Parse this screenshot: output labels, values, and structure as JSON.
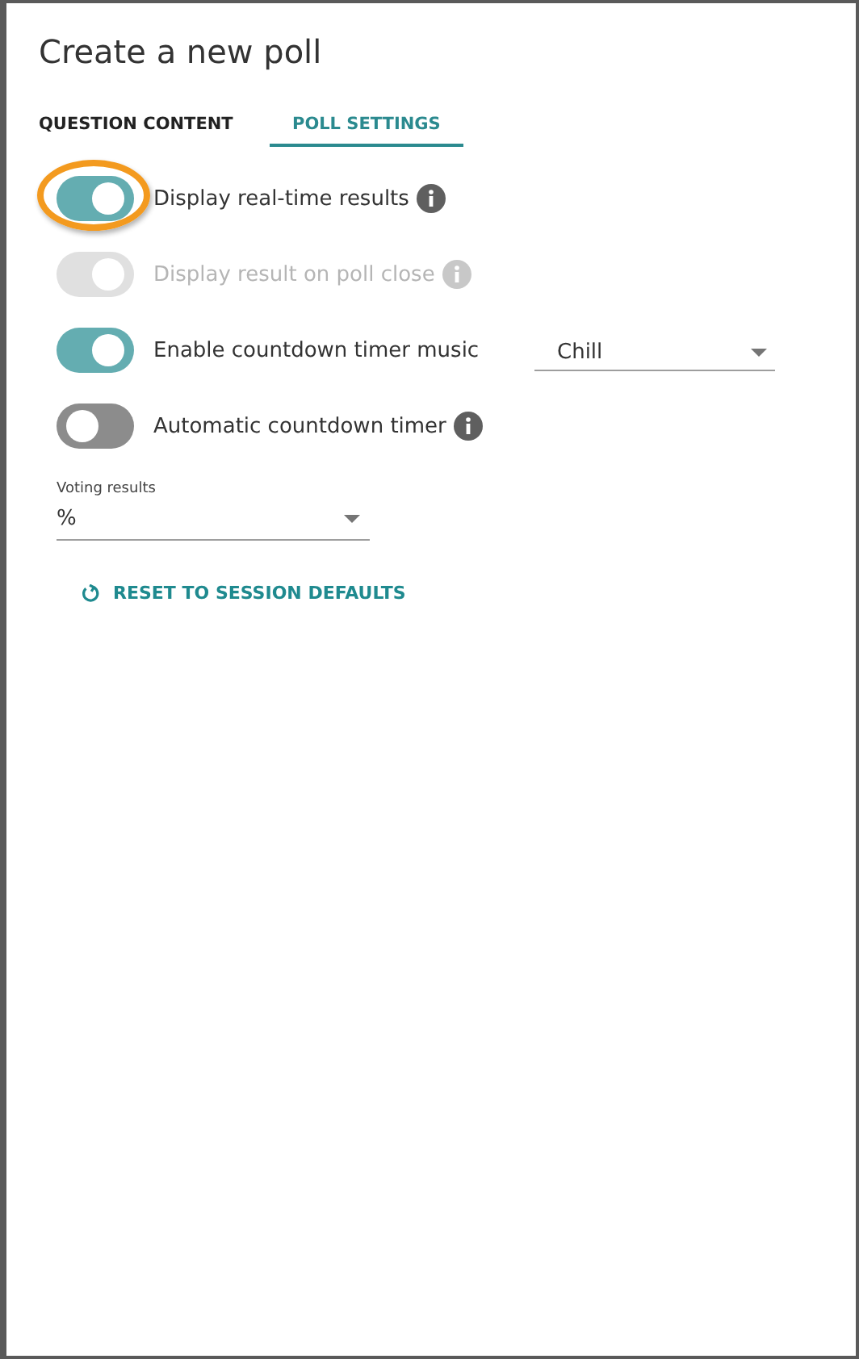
{
  "title": "Create a new poll",
  "tabs": [
    {
      "label": "QUESTION CONTENT",
      "selected": false
    },
    {
      "label": "POLL SETTINGS",
      "selected": true
    }
  ],
  "settings": [
    {
      "label": "Display real-time results",
      "on": true,
      "disabled": false,
      "info": true,
      "highlighted": true
    },
    {
      "label": "Display result on poll close",
      "on": true,
      "disabled": true,
      "info": true,
      "highlighted": false
    },
    {
      "label": "Enable countdown timer music",
      "on": true,
      "disabled": false,
      "info": false,
      "highlighted": false,
      "dropdown": {
        "value": "Chill"
      }
    },
    {
      "label": "Automatic countdown timer",
      "on": false,
      "disabled": false,
      "info": true,
      "highlighted": false
    }
  ],
  "voting_results": {
    "label": "Voting results",
    "value": "%"
  },
  "reset_button": "RESET TO SESSION DEFAULTS"
}
